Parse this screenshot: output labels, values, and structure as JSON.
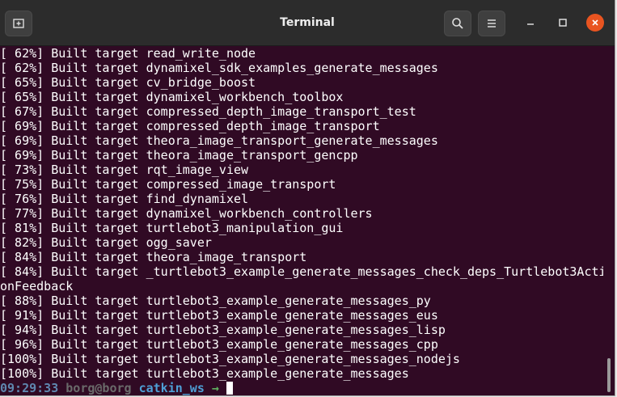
{
  "window": {
    "title": "Terminal"
  },
  "titlebar": {
    "new_tab_icon": "new-tab-icon",
    "search_icon": "search-icon",
    "menu_icon": "hamburger-menu-icon",
    "minimize_icon": "minimize-icon",
    "maximize_icon": "maximize-icon",
    "close_icon": "close-icon",
    "close_color": "#e95420"
  },
  "terminal": {
    "background": "#300a24",
    "lines": [
      "[ 62%] Built target read_write_node",
      "[ 62%] Built target dynamixel_sdk_examples_generate_messages",
      "[ 65%] Built target cv_bridge_boost",
      "[ 65%] Built target dynamixel_workbench_toolbox",
      "[ 67%] Built target compressed_depth_image_transport_test",
      "[ 69%] Built target compressed_depth_image_transport",
      "[ 69%] Built target theora_image_transport_generate_messages",
      "[ 69%] Built target theora_image_transport_gencpp",
      "[ 73%] Built target rqt_image_view",
      "[ 75%] Built target compressed_image_transport",
      "[ 76%] Built target find_dynamixel",
      "[ 77%] Built target dynamixel_workbench_controllers",
      "[ 81%] Built target turtlebot3_manipulation_gui",
      "[ 82%] Built target ogg_saver",
      "[ 84%] Built target theora_image_transport",
      "[ 84%] Built target _turtlebot3_example_generate_messages_check_deps_Turtlebot3Acti",
      "onFeedback",
      "[ 88%] Built target turtlebot3_example_generate_messages_py",
      "[ 91%] Built target turtlebot3_example_generate_messages_eus",
      "[ 94%] Built target turtlebot3_example_generate_messages_lisp",
      "[ 96%] Built target turtlebot3_example_generate_messages_cpp",
      "[100%] Built target turtlebot3_example_generate_messages_nodejs",
      "[100%] Built target turtlebot3_example_generate_messages"
    ],
    "prompt": {
      "time": "09:29:33",
      "user_host": "borg@borg",
      "directory": "catkin_ws",
      "arrow": "→"
    }
  }
}
